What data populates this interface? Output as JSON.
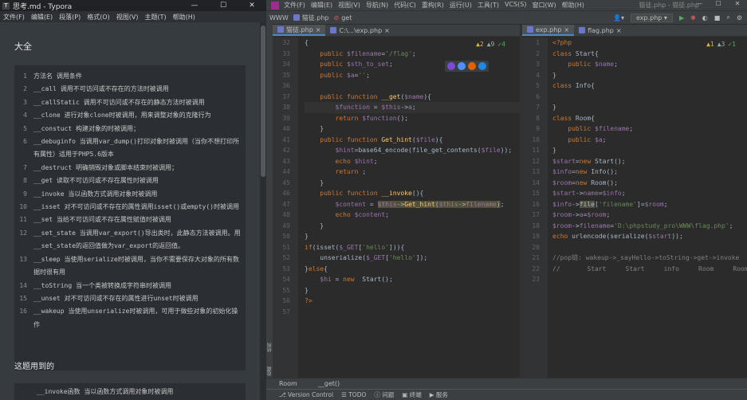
{
  "typora": {
    "title": "思考.md - Typora",
    "win_buttons": [
      "—",
      "☐",
      "✕"
    ],
    "menu": [
      "文件(F)",
      "编辑(E)",
      "段落(P)",
      "格式(O)",
      "视图(V)",
      "主题(T)",
      "帮助(H)"
    ],
    "heading1": "大全",
    "code_rows": [
      {
        "n": "1",
        "t": "方法名 调用条件"
      },
      {
        "n": "2",
        "t": "__call  调用不可访问或不存在的方法时被调用"
      },
      {
        "n": "3",
        "t": "__callStatic    调用不可访问或不存在的静态方法时被调用"
      },
      {
        "n": "4",
        "t": "__clone 进行对象clone时被调用，用来调整对象的克隆行为"
      },
      {
        "n": "5",
        "t": "__constuct  构建对象的时被调用；"
      },
      {
        "n": "6",
        "t": "__debuginfo 当调用var_dump()打印对象时被调用（当你不想打印所有属性）适用于PHP5.6版本"
      },
      {
        "n": "7",
        "t": "__destruct  明确销毁对象或脚本结束时被调用；"
      },
      {
        "n": "8",
        "t": "__get    读取不可访问或不存在属性时被调用"
      },
      {
        "n": "9",
        "t": "__invoke    当以函数方式调用对象时被调用"
      },
      {
        "n": "10",
        "t": "__isset 对不可访问或不存在的属性调用isset()或empty()时被调用"
      },
      {
        "n": "11",
        "t": "__set    当给不可访问或不存在属性赋值时被调用"
      },
      {
        "n": "12",
        "t": "__set_state 当调用var_export()导出类时，此静态方法被调用。用__set_state的返回值做为var_export的返回值。"
      },
      {
        "n": "13",
        "t": "__sleep 当使用serialize时被调用，当你不需要保存大对象的所有数据时很有用"
      },
      {
        "n": "14",
        "t": "__toString  当一个类被转换成字符串时被调用"
      },
      {
        "n": "15",
        "t": "__unset 对不可访问或不存在的属性进行unset时被调用"
      },
      {
        "n": "16",
        "t": "__wakeup    当使用unserialize时被调用，可用于做些对象的初始化操作"
      }
    ],
    "heading2": "这题用到的",
    "code2_first": "__invoke函数  当以函数方式调用对象时被调用"
  },
  "ide": {
    "menu": [
      "文件(F)",
      "编辑(E)",
      "视图(V)",
      "导航(N)",
      "代码(C)",
      "重构(R)",
      "运行(U)",
      "工具(T)",
      "VCS(S)",
      "窗口(W)",
      "帮助(H)"
    ],
    "window_title": "猫徒.php - 猫徒.php",
    "win_buttons": [
      "—",
      "☐",
      "✕"
    ],
    "breadcrumbs": [
      "WWW",
      "猫徒.php",
      "get"
    ],
    "run_config": "exp.php ▾",
    "left_tabs": [
      {
        "label": "猫徒.php",
        "active": true
      },
      {
        "label": "C:\\...\\exp.php",
        "active": false
      }
    ],
    "right_tabs": [
      {
        "label": "exp.php",
        "active": true
      },
      {
        "label": "flag.php",
        "active": false
      }
    ],
    "left_inspect": {
      "warn": "▲2",
      "weak": "▲9",
      "ok": "✓4"
    },
    "right_inspect": {
      "warn": "▲1",
      "weak": "▲3",
      "ok": "✓1"
    },
    "left_lines": [
      "32",
      "33",
      "34",
      "35",
      "36",
      "37",
      "38",
      "39",
      "40",
      "41",
      "42",
      "43",
      "44",
      "45",
      "46",
      "47",
      "48",
      "49",
      "50",
      "51",
      "52",
      "53",
      "54",
      "55",
      "56",
      "57"
    ],
    "right_lines": [
      "1",
      "2",
      "3",
      "4",
      "5",
      "6",
      "7",
      "8",
      "9",
      "10",
      "11",
      "12",
      "13",
      "14",
      "15",
      "16",
      "17",
      "18",
      "19",
      "20",
      "21",
      "22",
      "23"
    ],
    "status_crumbs": [
      "Room",
      "__get()"
    ],
    "bottom_items": [
      "Version Control",
      "TODO",
      "问题",
      "终端",
      "服务"
    ],
    "side_labels": [
      "结构",
      "收藏"
    ]
  }
}
